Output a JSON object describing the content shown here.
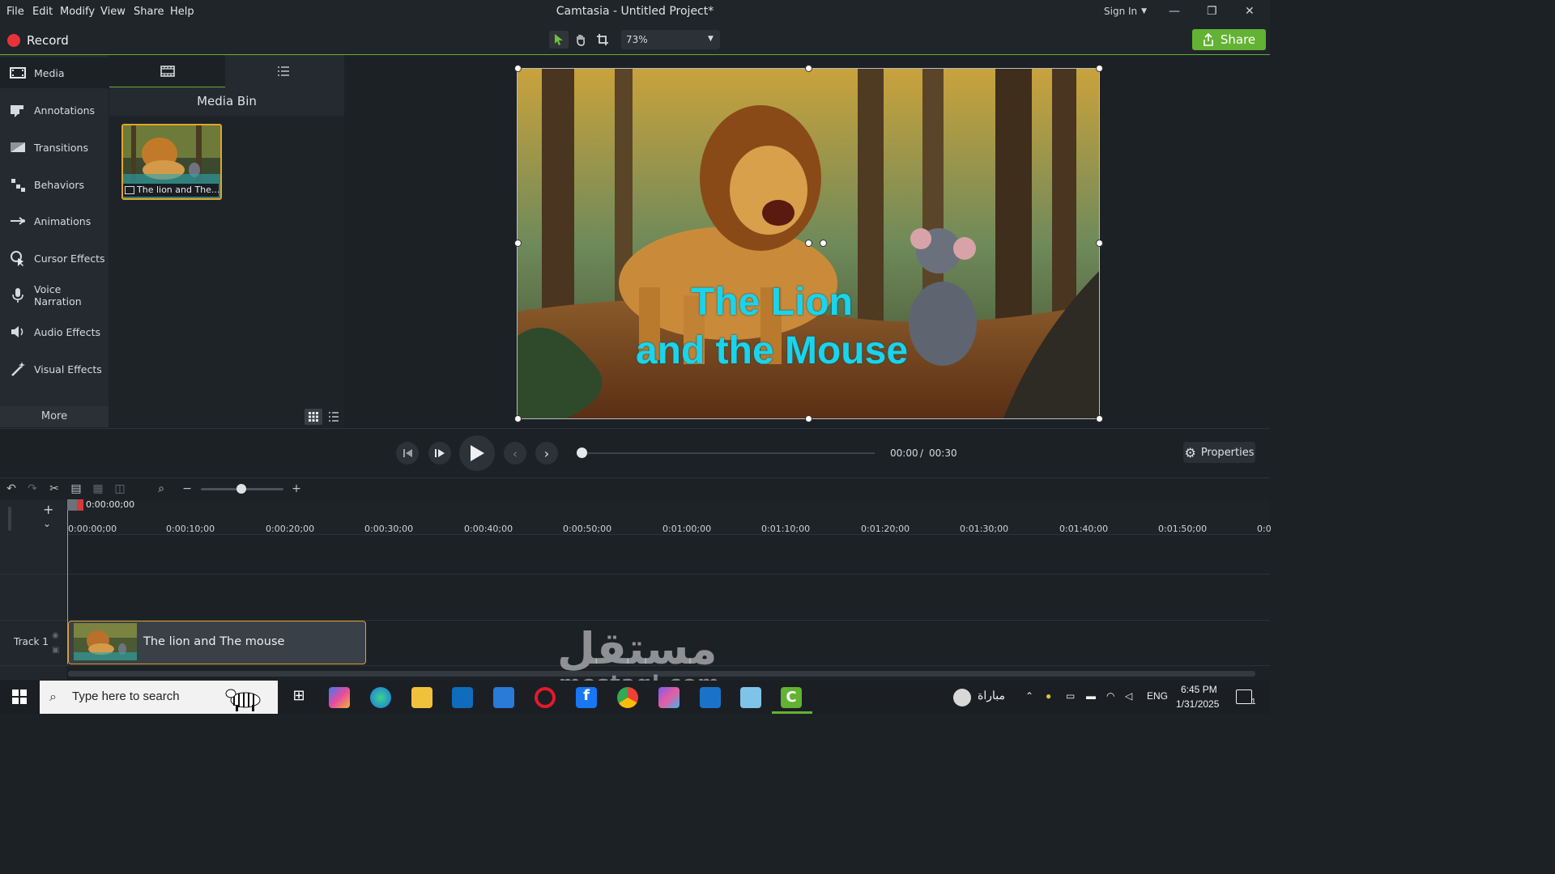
{
  "menu": [
    "File",
    "Edit",
    "Modify",
    "View",
    "Share",
    "Help"
  ],
  "app_title": "Camtasia - Untitled Project*",
  "sign_in": "Sign In",
  "toolbar": {
    "record_label": "Record",
    "zoom": "73%",
    "share_label": "Share"
  },
  "sidebar": {
    "items": [
      {
        "label": "Media",
        "icon": "film-icon"
      },
      {
        "label": "Annotations",
        "icon": "annotation-icon"
      },
      {
        "label": "Transitions",
        "icon": "transition-icon"
      },
      {
        "label": "Behaviors",
        "icon": "behaviors-icon"
      },
      {
        "label": "Animations",
        "icon": "animation-icon"
      },
      {
        "label": "Cursor Effects",
        "icon": "cursor-icon"
      },
      {
        "label": "Voice Narration",
        "icon": "microphone-icon"
      },
      {
        "label": "Audio Effects",
        "icon": "speaker-icon"
      },
      {
        "label": "Visual Effects",
        "icon": "wand-icon"
      }
    ],
    "more_label": "More"
  },
  "media_bin": {
    "title": "Media Bin",
    "item_label": "The lion and The..."
  },
  "canvas": {
    "title_line1": "The Lion",
    "title_line2": "and the Mouse"
  },
  "playback": {
    "current_time": "00:00",
    "separator": "/",
    "total_time": "00:30",
    "properties_label": "Properties"
  },
  "timeline": {
    "playhead_time": "0:00:00;00",
    "ticks": [
      "0:00:00;00",
      "0:00:10;00",
      "0:00:20;00",
      "0:00:30;00",
      "0:00:40;00",
      "0:00:50;00",
      "0:01:00;00",
      "0:01:10;00",
      "0:01:20;00",
      "0:01:30;00",
      "0:01:40;00",
      "0:01:50;00",
      "0:0"
    ],
    "track1_label": "Track 1",
    "clip_label": "The lion and The mouse"
  },
  "taskbar": {
    "search_placeholder": "Type here to search",
    "weather_text": "مباراة",
    "language": "ENG",
    "time": "6:45 PM",
    "date": "1/31/2025",
    "notification_count": "1"
  },
  "watermark": {
    "arabic": "مستقل",
    "latin": "mostaql.com"
  },
  "colors": {
    "accent_green": "#63b233",
    "title_cyan": "#19d4ec",
    "clip_border": "#d9a230",
    "record_red": "#e8333a"
  }
}
